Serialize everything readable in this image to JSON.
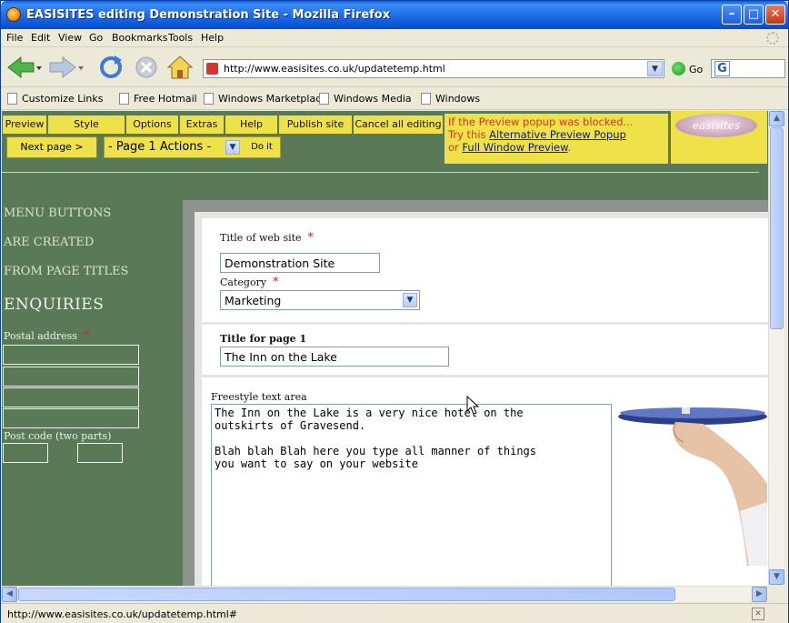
{
  "window": {
    "title": "EASISITES editing Demonstration Site - Mozilla Firefox"
  },
  "menu": [
    "File",
    "Edit",
    "View",
    "Go",
    "Bookmarks",
    "Tools",
    "Help"
  ],
  "nav": {
    "url": "http://www.easisites.co.uk/updatetemp.html",
    "go_label": "Go",
    "search_glyph": "G"
  },
  "bookmarks": [
    "Customize Links",
    "Free Hotmail",
    "Windows Marketplace",
    "Windows Media",
    "Windows"
  ],
  "editor_toolbar": {
    "buttons": [
      "Preview",
      "Style",
      "Options",
      "Extras",
      "Help",
      "Publish site",
      "Cancel all editing"
    ],
    "next_page": "Next page >",
    "page_actions": "- Page 1 Actions -",
    "do_it": "Do it"
  },
  "popup_note": {
    "line1": "If the Preview popup was blocked...",
    "line2_prefix": "Try this ",
    "alt_link": "Alternative Preview Popup",
    "line3_prefix": "or ",
    "full_link": "Full Window Preview",
    "line3_suffix": "."
  },
  "logo": {
    "text": "easisites"
  },
  "left_menu": {
    "items": [
      "MENU BUTTONS",
      "ARE CREATED",
      "FROM PAGE TITLES"
    ],
    "heading": "ENQUIRIES",
    "postal_label": "Postal address",
    "postcode_label": "Post code (two parts)",
    "required_mark": "*"
  },
  "form": {
    "site_title_label": "Title of web site",
    "site_title_value": "Demonstration Site",
    "category_label": "Category",
    "category_value": "Marketing",
    "page_title_label": "Title for page 1",
    "page_title_value": "The Inn on the Lake",
    "freestyle_label": "Freestyle text area",
    "freestyle_text": "The Inn on the Lake is a very nice hotel on the\noutskirts of Gravesend.\n\nBlah blah Blah here you type all manner of things\nyou want to say on your website",
    "required_mark": "*"
  },
  "status": {
    "text": "http://www.easisites.co.uk/updatetemp.html#"
  },
  "colors": {
    "page_green": "#5a7a57",
    "toolbar_yellow": "#efe14a",
    "note_red": "#d13a18",
    "required_red": "#d8281a"
  }
}
